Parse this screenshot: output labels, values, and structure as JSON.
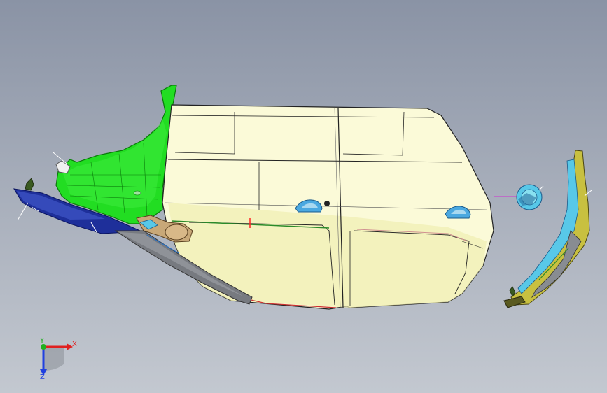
{
  "viewport": {
    "background_top": "#8a93a5",
    "background_bottom": "#c3c8d0"
  },
  "colors": {
    "door_panel": "#fbfad8",
    "door_panel_shade": "#efeeb2",
    "fender": "#22dd22",
    "front_bumper": "#1e2f9a",
    "step_trim": "#777a80",
    "accent_line": "#ff2222",
    "handle": "#4aa8e0",
    "rear_bracket": "#c8c040",
    "fuel_cap": "#58c8e8",
    "magenta_line": "#d030d0"
  },
  "triad": {
    "x_label": "X",
    "y_label": "Y",
    "z_label": "Z",
    "x_color": "#e02020",
    "y_color": "#20b020",
    "z_color": "#2040e0"
  },
  "icons": [
    "axis-triad-icon"
  ]
}
